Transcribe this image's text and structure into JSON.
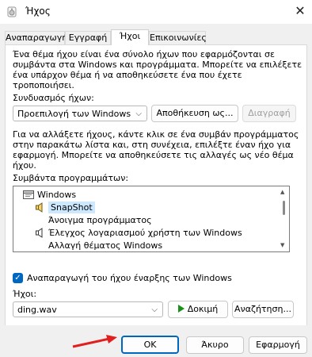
{
  "window": {
    "title": "Ήχος",
    "close_symbol": "✕"
  },
  "tabs": [
    {
      "label": "Αναπαραγωγή"
    },
    {
      "label": "Εγγραφή"
    },
    {
      "label": "Ήχοι"
    },
    {
      "label": "Επικοινωνίες"
    }
  ],
  "active_tab": "Ήχοι",
  "scheme": {
    "description": [
      "Ένα θέμα ήχου είναι ένα σύνολο ήχων που εφαρμόζονται σε",
      "συμβάντα στα Windows και προγράμματα. Μπορείτε να επιλέξετε",
      "ένα υπάρχον θέμα ή να αποθηκεύσετε ένα που έχετε",
      "τροποποιήσει."
    ],
    "label": "Συνδυασμός ήχων:",
    "selected": "Προεπιλογή των Windows",
    "save_label": "Αποθήκευση ως...",
    "delete_label": "Διαγραφή"
  },
  "events": {
    "description": [
      "Για να αλλάξετε ήχους, κάντε κλικ σε ένα συμβάν προγράμματος",
      "στην παρακάτω λίστα και, στη συνέχεια, επιλέξτε έναν ήχο για",
      "εφαρμογή. Μπορείτε να αποθηκεύσετε τις αλλαγές ως νέο θέμα",
      "ήχου."
    ],
    "label": "Συμβάντα προγραμμάτων:",
    "items": [
      {
        "label": "Windows",
        "icon": "windows-folder-icon"
      },
      {
        "label": "SnapShot",
        "icon": "speaker-icon",
        "selected": true
      },
      {
        "label": "Άνοιγμα προγράμματος",
        "icon": ""
      },
      {
        "label": "Έλεγχος λογαριασμού χρήστη των Windows",
        "icon": "speaker-icon"
      },
      {
        "label": "Αλλαγή θέματος Windows",
        "icon": ""
      }
    ]
  },
  "startup_sound": {
    "label": "Αναπαραγωγή του ήχου έναρξης των Windows",
    "checked": true
  },
  "sounds": {
    "label": "Ήχοι:",
    "selected": "ding.wav",
    "test_label": "Δοκιμή",
    "browse_label": "Αναζήτηση..."
  },
  "footer": {
    "ok_label": "OK",
    "cancel_label": "Άκυρο",
    "apply_label": "Εφαρμογή"
  },
  "colors": {
    "accent": "#0067c0",
    "selection": "#cce8ff",
    "annotation_arrow": "#e02020",
    "play_green": "#1a8f1a"
  }
}
